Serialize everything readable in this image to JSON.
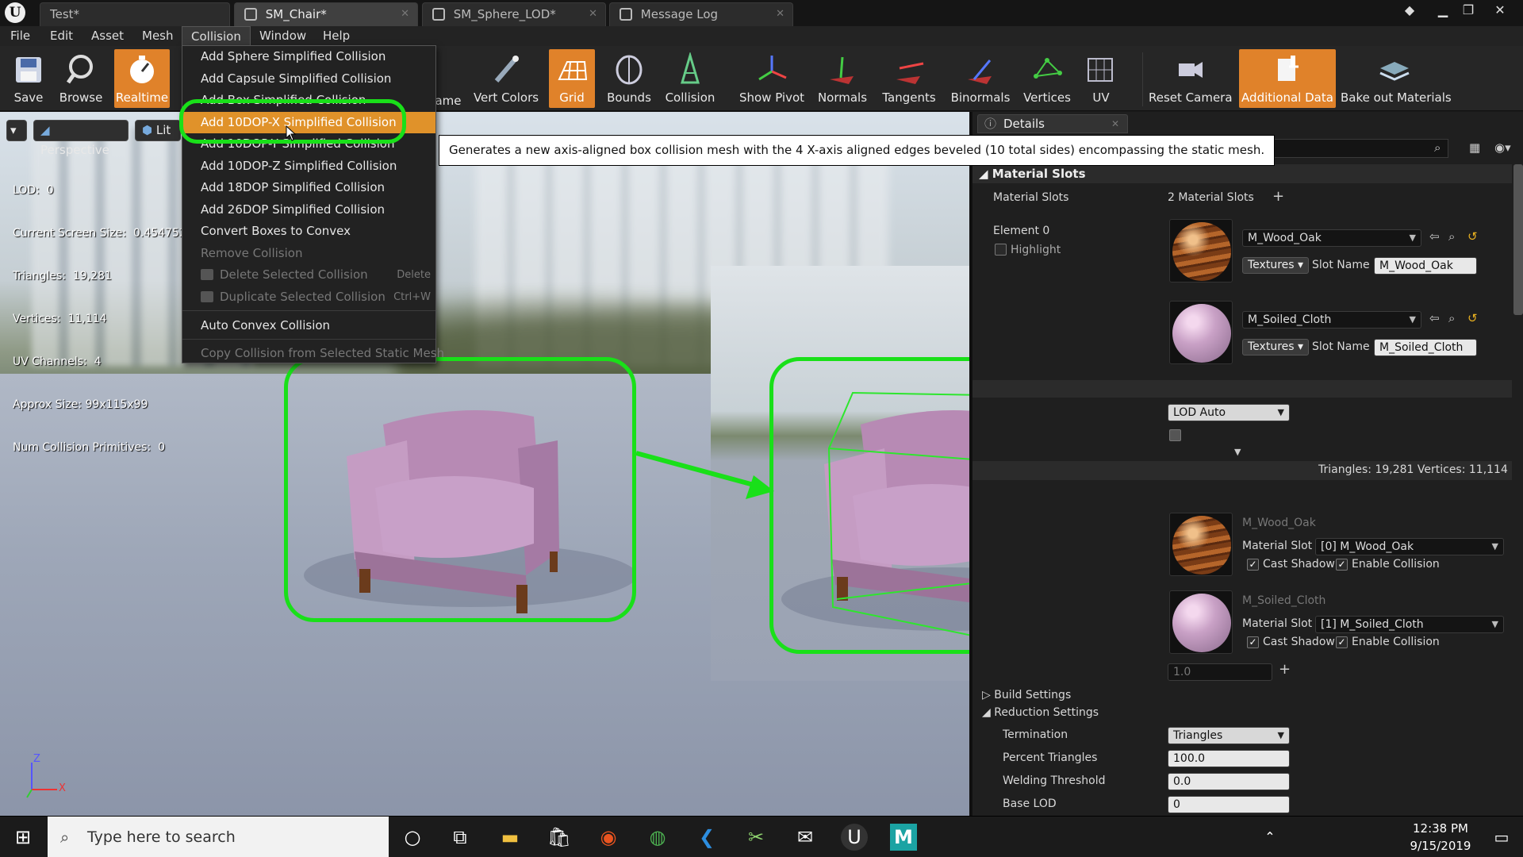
{
  "window": {
    "tabs": [
      {
        "label": "Test*"
      },
      {
        "label": "SM_Chair*"
      },
      {
        "label": "SM_Sphere_LOD*"
      },
      {
        "label": "Message Log"
      }
    ]
  },
  "menubar": {
    "items": [
      "File",
      "Edit",
      "Asset",
      "Mesh",
      "Collision",
      "Window",
      "Help"
    ]
  },
  "toolbar": {
    "buttons": [
      {
        "label": "Save",
        "icon": "save-icon"
      },
      {
        "label": "Browse",
        "icon": "browse-icon"
      },
      {
        "label": "Realtime",
        "icon": "realtime-icon",
        "active": true
      },
      {
        "label": "ame",
        "icon": ""
      },
      {
        "label": "Vert Colors",
        "icon": "vert-colors-icon"
      },
      {
        "label": "Grid",
        "icon": "grid-icon",
        "active": true
      },
      {
        "label": "Bounds",
        "icon": "bounds-icon"
      },
      {
        "label": "Collision",
        "icon": "collision-icon"
      },
      {
        "label": "Show Pivot",
        "icon": "pivot-icon"
      },
      {
        "label": "Normals",
        "icon": "normals-icon"
      },
      {
        "label": "Tangents",
        "icon": "tangents-icon"
      },
      {
        "label": "Binormals",
        "icon": "binormals-icon"
      },
      {
        "label": "Vertices",
        "icon": "vertices-icon"
      },
      {
        "label": "UV",
        "icon": "uv-icon"
      },
      {
        "label": "Reset Camera",
        "icon": "camera-icon"
      },
      {
        "label": "Additional Data",
        "icon": "additional-data-icon",
        "active": true
      },
      {
        "label": "Bake out Materials",
        "icon": "bake-icon"
      }
    ]
  },
  "viewport": {
    "perspective": "Perspective",
    "lit": "Lit",
    "stats": [
      "LOD:  0",
      "Current Screen Size:  0.454752",
      "Triangles:  19,281",
      "Vertices:  11,114",
      "UV Channels:  4",
      "Approx Size: 99x115x99",
      "Num Collision Primitives:  0"
    ],
    "axis_z": "Z",
    "axis_x": "X"
  },
  "collision_menu": {
    "items": [
      {
        "label": "Add Sphere Simplified Collision",
        "disabled": false
      },
      {
        "label": "Add Capsule Simplified Collision",
        "disabled": false
      },
      {
        "label": "Add Box Simplified Collision",
        "disabled": false
      },
      {
        "label": "Add 10DOP-X Simplified Collision",
        "disabled": false,
        "highlighted": true
      },
      {
        "label": "Add 10DOP-Y Simplified Collision",
        "disabled": false
      },
      {
        "label": "Add 10DOP-Z Simplified Collision",
        "disabled": false
      },
      {
        "label": "Add 18DOP Simplified Collision",
        "disabled": false
      },
      {
        "label": "Add 26DOP Simplified Collision",
        "disabled": false
      },
      {
        "label": "Convert Boxes to Convex",
        "disabled": false
      },
      {
        "label": "Remove Collision",
        "disabled": true
      },
      {
        "label": "Delete Selected Collision",
        "disabled": true,
        "shortcut": "Delete"
      },
      {
        "label": "Duplicate Selected Collision",
        "disabled": true,
        "shortcut": "Ctrl+W"
      },
      {
        "label": "Auto Convex Collision",
        "disabled": false
      },
      {
        "label": "Copy Collision from Selected Static Mesh",
        "disabled": true
      }
    ],
    "tooltip": "Generates a new axis-aligned box collision mesh with the 4 X-axis aligned edges beveled (10 total sides) encompassing the static mesh."
  },
  "details": {
    "tab_label": "Details",
    "material_slots_category": "Material Slots",
    "material_slots_label": "Material Slots",
    "material_slots_count": "2 Material Slots",
    "element0_label": "Element 0",
    "highlight_label": "Highlight",
    "slots": [
      {
        "material": "M_Wood_Oak",
        "textures": "Textures",
        "slot_name_label": "Slot Name",
        "slot_name": "M_Wood_Oak",
        "swatch": "wood"
      },
      {
        "material": "M_Soiled_Cloth",
        "textures": "Textures",
        "slot_name_label": "Slot Name",
        "slot_name": "M_Soiled_Cloth",
        "swatch": "cloth"
      }
    ],
    "lod_combo": "LOD Auto",
    "lod_stats": "Triangles: 19,281   Vertices: 11,114",
    "sections": [
      {
        "material": "M_Wood_Oak",
        "slot_label": "Material Slot",
        "slot_value": "[0] M_Wood_Oak",
        "cast_shadow": "Cast Shadow",
        "enable_collision": "Enable Collision"
      },
      {
        "material": "M_Soiled_Cloth",
        "slot_label": "Material Slot",
        "slot_value": "[1] M_Soiled_Cloth",
        "cast_shadow": "Cast Shadow",
        "enable_collision": "Enable Collision"
      }
    ],
    "screen_size_value": "1.0",
    "build_settings": "Build Settings",
    "reduction_settings": "Reduction Settings",
    "props": [
      {
        "label": "Termination",
        "value": "Triangles",
        "kind": "combo"
      },
      {
        "label": "Percent Triangles",
        "value": "100.0",
        "kind": "num"
      },
      {
        "label": "Welding Threshold",
        "value": "0.0",
        "kind": "num"
      },
      {
        "label": "Base LOD",
        "value": "0",
        "kind": "num"
      }
    ]
  },
  "taskbar": {
    "search_placeholder": "Type here to search",
    "time": "12:38 PM",
    "date": "9/15/2019"
  },
  "colors": {
    "accent_orange": "#e0822a",
    "annotation_green": "#19e019"
  }
}
